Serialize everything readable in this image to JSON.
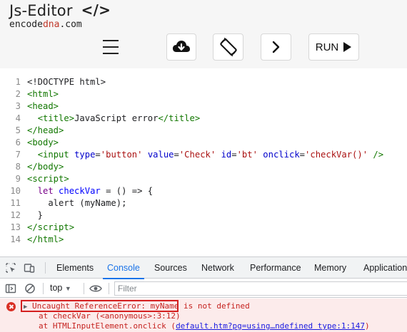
{
  "brand": {
    "title": "Js-Editor",
    "code_symbol": "</>",
    "subtitle_pre": "encode",
    "subtitle_mid": "dna",
    "subtitle_post": ".com"
  },
  "toolbar": {
    "run_label": "RUN"
  },
  "editor": {
    "lines": [
      {
        "n": "1"
      },
      {
        "n": "2"
      },
      {
        "n": "3"
      },
      {
        "n": "4"
      },
      {
        "n": "5"
      },
      {
        "n": "6"
      },
      {
        "n": "7"
      },
      {
        "n": "8"
      },
      {
        "n": "9"
      },
      {
        "n": "10"
      },
      {
        "n": "11"
      },
      {
        "n": "12"
      },
      {
        "n": "13"
      },
      {
        "n": "14"
      }
    ]
  },
  "devtools": {
    "tabs": [
      "Elements",
      "Console",
      "Sources",
      "Network",
      "Performance",
      "Memory",
      "Application"
    ],
    "active_tab": "Console",
    "context": "top",
    "filter_placeholder": "Filter",
    "error": {
      "highlighted": "Uncaught ReferenceError: myName",
      "rest": " is not defined",
      "stack1": "at checkVar (<anonymous>:3:12)",
      "stack2_pre": "at HTMLInputElement.onclick (",
      "stack2_link": "default.htm?pg=using…ndefined type:1:147",
      "stack2_post": ")"
    }
  },
  "colors": {
    "accent": "#1a73e8",
    "error_red": "#d93025",
    "error_bg": "#fcebeb"
  }
}
